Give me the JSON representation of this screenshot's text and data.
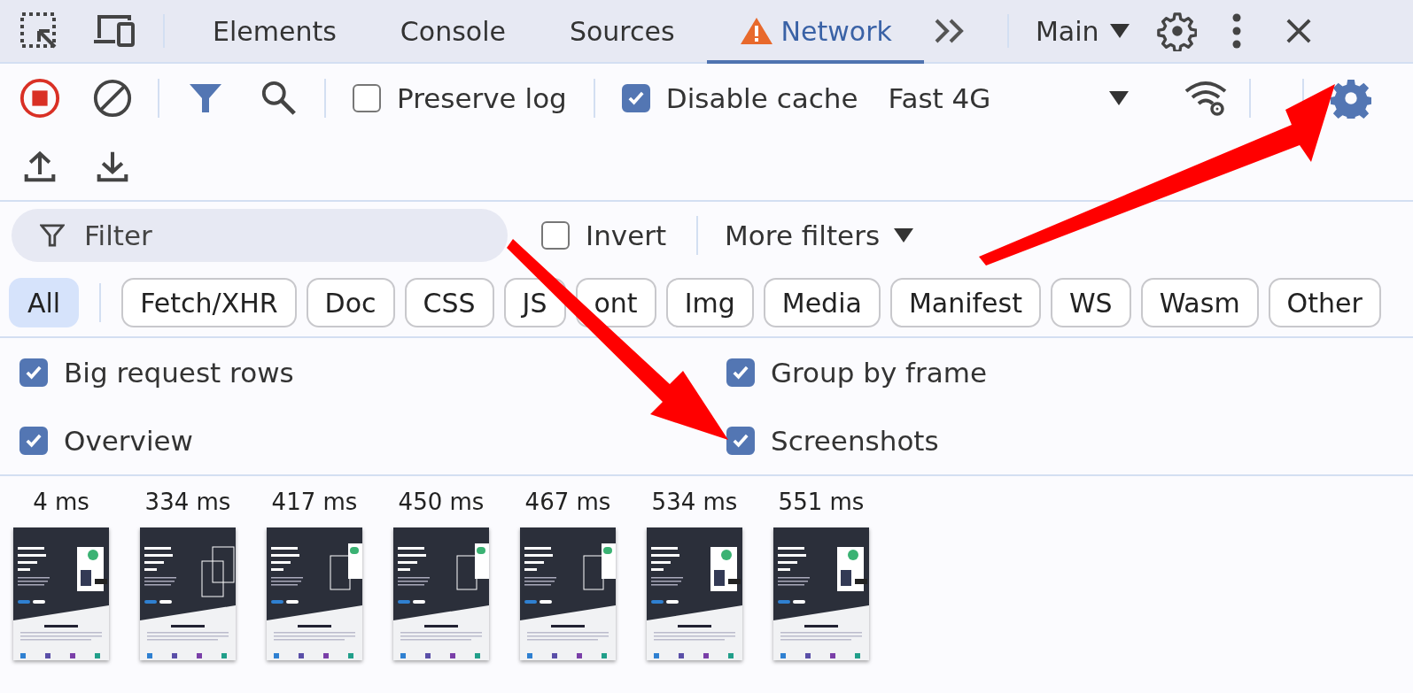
{
  "tabs": [
    {
      "label": "Elements",
      "selected": false,
      "warning": false
    },
    {
      "label": "Console",
      "selected": false,
      "warning": false
    },
    {
      "label": "Sources",
      "selected": false,
      "warning": false
    },
    {
      "label": "Network",
      "selected": true,
      "warning": true
    }
  ],
  "context": "Main",
  "network_toolbar": {
    "recording": true,
    "preserve_log": {
      "label": "Preserve log",
      "checked": false
    },
    "disable_cache": {
      "label": "Disable cache",
      "checked": true
    },
    "throttling": "Fast 4G"
  },
  "filter": {
    "placeholder": "Filter",
    "invert": {
      "label": "Invert",
      "checked": false
    },
    "more_filters": "More filters"
  },
  "types": [
    {
      "label": "All",
      "selected": true
    },
    {
      "label": "Fetch/XHR",
      "selected": false
    },
    {
      "label": "Doc",
      "selected": false
    },
    {
      "label": "CSS",
      "selected": false
    },
    {
      "label": "JS",
      "selected": false
    },
    {
      "label": "ont",
      "selected": false
    },
    {
      "label": "Img",
      "selected": false
    },
    {
      "label": "Media",
      "selected": false
    },
    {
      "label": "Manifest",
      "selected": false
    },
    {
      "label": "WS",
      "selected": false
    },
    {
      "label": "Wasm",
      "selected": false
    },
    {
      "label": "Other",
      "selected": false
    }
  ],
  "settings": [
    {
      "label": "Big request rows",
      "checked": true
    },
    {
      "label": "Group by frame",
      "checked": true
    },
    {
      "label": "Overview",
      "checked": true
    },
    {
      "label": "Screenshots",
      "checked": true
    }
  ],
  "screenshots": [
    {
      "time": "4 ms",
      "kind": "full"
    },
    {
      "time": "334 ms",
      "kind": "outline"
    },
    {
      "time": "417 ms",
      "kind": "partial"
    },
    {
      "time": "450 ms",
      "kind": "partial"
    },
    {
      "time": "467 ms",
      "kind": "partial"
    },
    {
      "time": "534 ms",
      "kind": "full"
    },
    {
      "time": "551 ms",
      "kind": "full"
    }
  ]
}
